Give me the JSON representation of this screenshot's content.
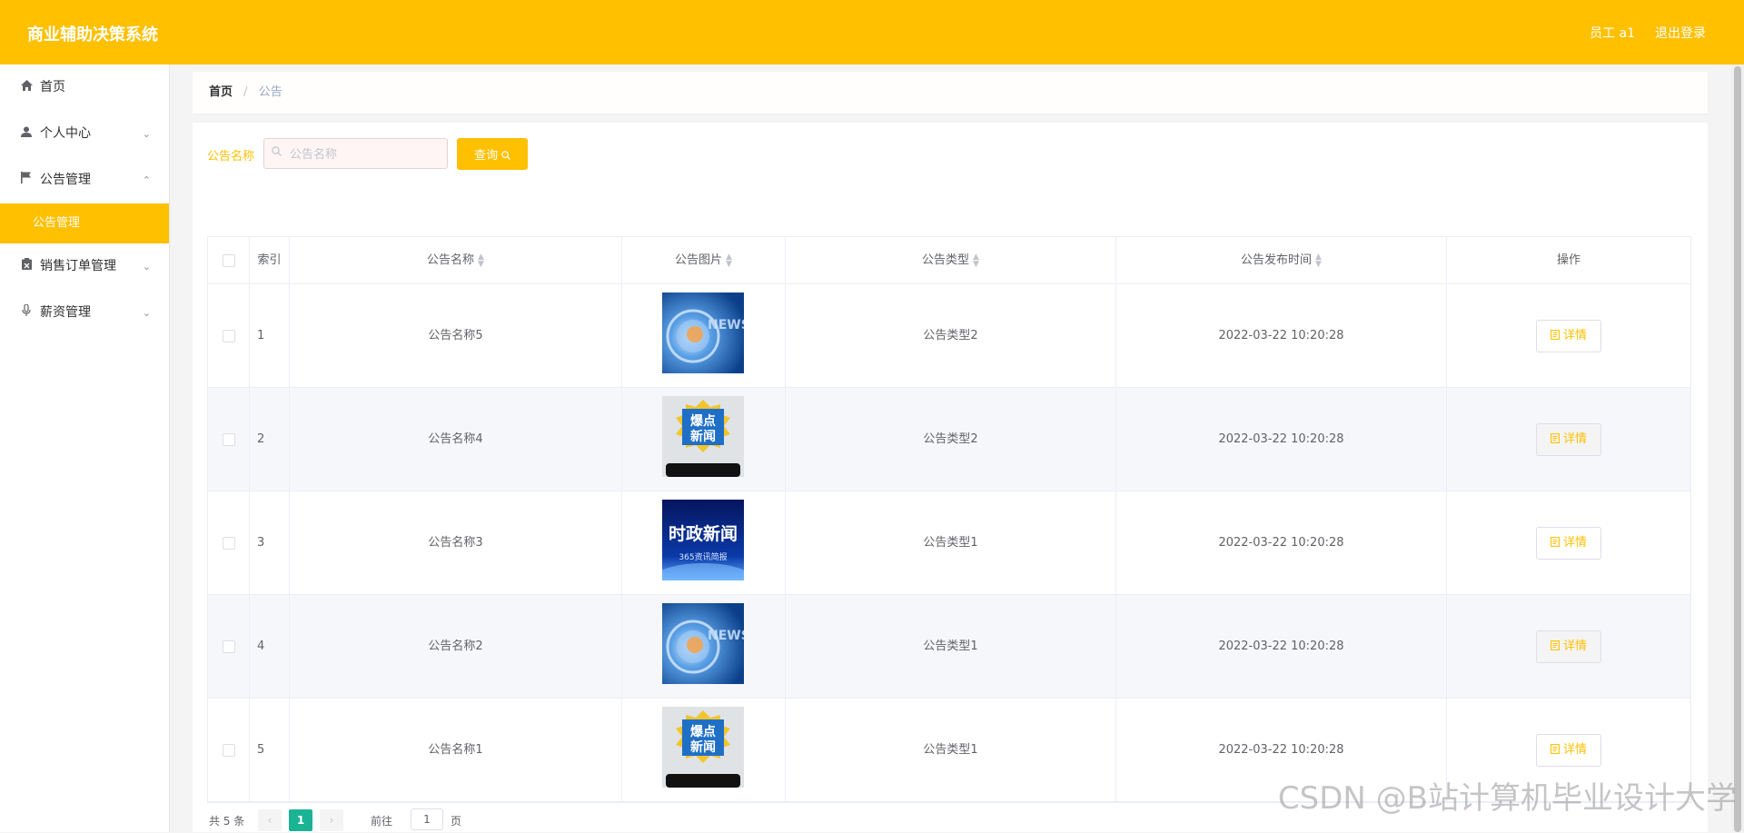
{
  "header": {
    "app_title": "商业辅助决策系统",
    "user_label": "员工 a1",
    "logout_label": "退出登录",
    "bg_color": "#ffc000"
  },
  "sidebar": {
    "items": [
      {
        "label": "首页",
        "icon": "home-icon"
      },
      {
        "label": "个人中心",
        "icon": "user-icon",
        "chevron": "down"
      },
      {
        "label": "公告管理",
        "icon": "flag-icon",
        "chevron": "up",
        "expanded": true
      },
      {
        "label": "销售订单管理",
        "icon": "clipboard-icon",
        "chevron": "down"
      },
      {
        "label": "薪资管理",
        "icon": "microphone-icon",
        "chevron": "down"
      }
    ],
    "submenu": {
      "label": "公告管理",
      "active": true
    }
  },
  "breadcrumb": {
    "home": "首页",
    "separator": "/",
    "current": "公告"
  },
  "search": {
    "label": "公告名称",
    "placeholder": "公告名称",
    "value": "",
    "button_label": "查询"
  },
  "table": {
    "columns": [
      "索引",
      "公告名称",
      "公告图片",
      "公告类型",
      "公告发布时间",
      "操作"
    ],
    "rows": [
      {
        "index": "1",
        "name": "公告名称5",
        "image": "news-globe",
        "type": "公告类型2",
        "time": "2022-03-22 10:20:28",
        "action": "详情"
      },
      {
        "index": "2",
        "name": "公告名称4",
        "image": "hot-news",
        "type": "公告类型2",
        "time": "2022-03-22 10:20:28",
        "action": "详情"
      },
      {
        "index": "3",
        "name": "公告名称3",
        "image": "politics-news",
        "type": "公告类型1",
        "time": "2022-03-22 10:20:28",
        "action": "详情"
      },
      {
        "index": "4",
        "name": "公告名称2",
        "image": "news-globe",
        "type": "公告类型1",
        "time": "2022-03-22 10:20:28",
        "action": "详情"
      },
      {
        "index": "5",
        "name": "公告名称1",
        "image": "hot-news",
        "type": "公告类型1",
        "time": "2022-03-22 10:20:28",
        "action": "详情"
      }
    ]
  },
  "images": {
    "news_globe_text": "NEWS",
    "hot_news_text": [
      "爆点",
      "新闻"
    ],
    "politics_title": "时政新闻",
    "politics_sub": "365资讯简报"
  },
  "pagination": {
    "total_label": "共 5 条",
    "current_page": "1",
    "goto_label": "前往",
    "goto_value": "1",
    "goto_unit": "页"
  },
  "watermark": "CSDN @B站计算机毕业设计大学"
}
